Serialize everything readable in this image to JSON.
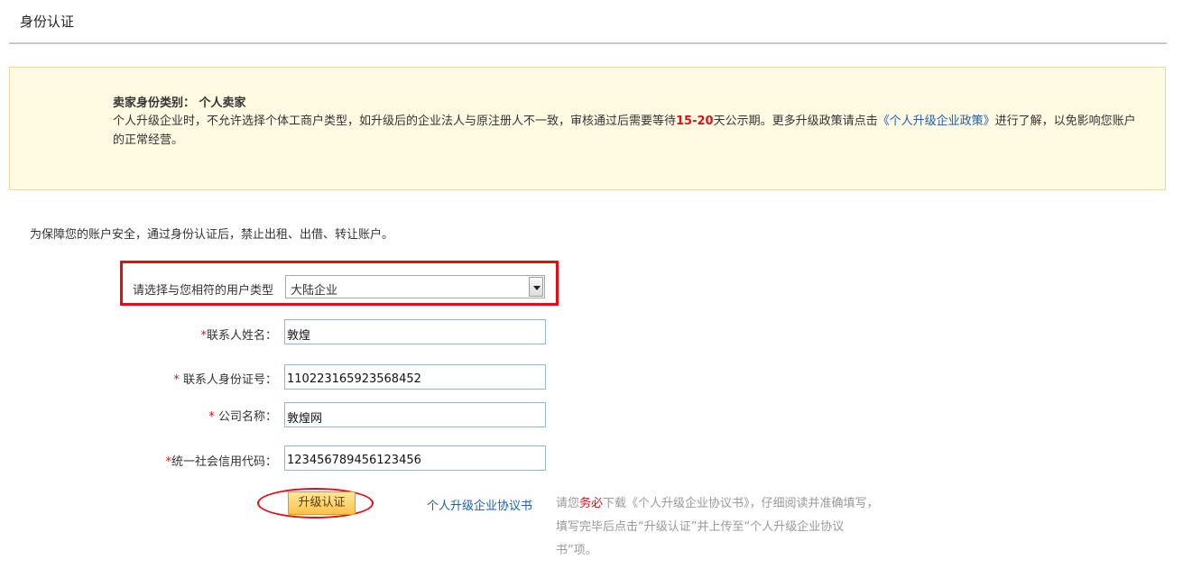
{
  "page": {
    "title": "身份认证"
  },
  "notice": {
    "heading": "卖家身份类别： 个人卖家",
    "text_part1": "个人升级企业时，不允许选择个体工商户类型，如升级后的企业法人与原注册人不一致，审核通过后需要等待",
    "highlight_days": "15-20",
    "text_part2": "天公示期。更多升级政策请点击",
    "policy_link": "《个人升级企业政策》",
    "text_part3": "进行了解，以免影响您账户的正常经营。"
  },
  "intro": "为保障您的账户安全，通过身份认证后，禁止出租、出借、转让账户。",
  "form": {
    "user_type": {
      "label": "请选择与您相符的用户类型",
      "selected": "大陆企业"
    },
    "contact_name": {
      "label": "联系人姓名：",
      "value": "敦煌"
    },
    "contact_id": {
      "label": "联系人身份证号：",
      "value": "110223165923568452"
    },
    "company_name": {
      "label": "公司名称：",
      "value": "敦煌网"
    },
    "credit_code": {
      "label": "统一社会信用代码：",
      "value": "123456789456123456"
    },
    "required_mark": "*"
  },
  "actions": {
    "upgrade_button": "升级认证",
    "agreement_link": "个人升级企业协议书"
  },
  "hint": {
    "part1": "请您",
    "emphasis": "务必",
    "part2": "下载《个人升级企业协议书》，仔细阅读并准确填写，填写完毕后点击“升级认证”并上传至“个人升级企业协议书”项。"
  },
  "colors": {
    "accent_red": "#d0181b",
    "link_blue": "#1d5fb0",
    "notice_bg": "#fffbe3"
  }
}
